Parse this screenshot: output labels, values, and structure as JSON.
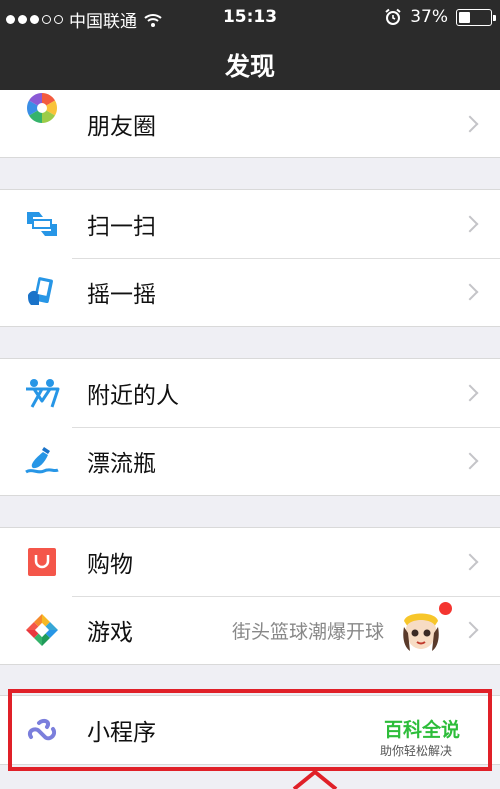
{
  "status_bar": {
    "carrier": "中国联通",
    "time": "15:13",
    "battery": "37%",
    "battery_level": 0.37
  },
  "nav": {
    "title": "发现"
  },
  "items": {
    "moments": {
      "label": "朋友圈",
      "icon": "moments-icon"
    },
    "scan": {
      "label": "扫一扫",
      "icon": "scan-icon"
    },
    "shake": {
      "label": "摇一摇",
      "icon": "shake-icon"
    },
    "nearby": {
      "label": "附近的人",
      "icon": "people-nearby-icon"
    },
    "bottle": {
      "label": "漂流瓶",
      "icon": "drift-bottle-icon"
    },
    "shopping": {
      "label": "购物",
      "icon": "shopping-bag-icon"
    },
    "games": {
      "label": "游戏",
      "sub": "街头篮球潮爆开球",
      "icon": "games-icon"
    },
    "mini_programs": {
      "label": "小程序",
      "icon": "mini-program-icon"
    }
  },
  "watermark": {
    "title": "百科全说",
    "subtitle": "助你轻松解决"
  },
  "colors": {
    "bar": "#2b2b2b",
    "background": "#efeff4",
    "highlight": "#e02028",
    "badge": "#f43530",
    "watermark": "#2dbd3a"
  }
}
